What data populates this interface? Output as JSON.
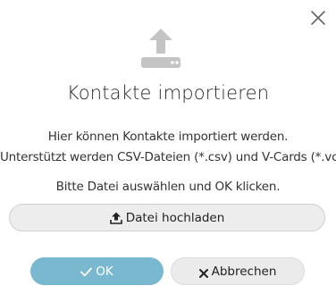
{
  "dialog": {
    "title": "Kontakte importieren",
    "description_line1": "Hier können Kontakte importiert werden.",
    "description_line2": "Unterstützt werden CSV-Dateien (*.csv) und V-Cards (*.vcf).",
    "instruction": "Bitte Datei auswählen und OK klicken.",
    "upload_label": "Datei hochladen",
    "ok_label": "OK",
    "cancel_label": "Abbrechen"
  },
  "icons": {
    "close": "close-icon",
    "header": "upload-tray-icon",
    "upload": "upload-icon",
    "ok": "check-icon",
    "cancel": "x-icon"
  },
  "colors": {
    "ok_button": "#7ab8cf",
    "icon_gray": "#c4c4c4"
  }
}
